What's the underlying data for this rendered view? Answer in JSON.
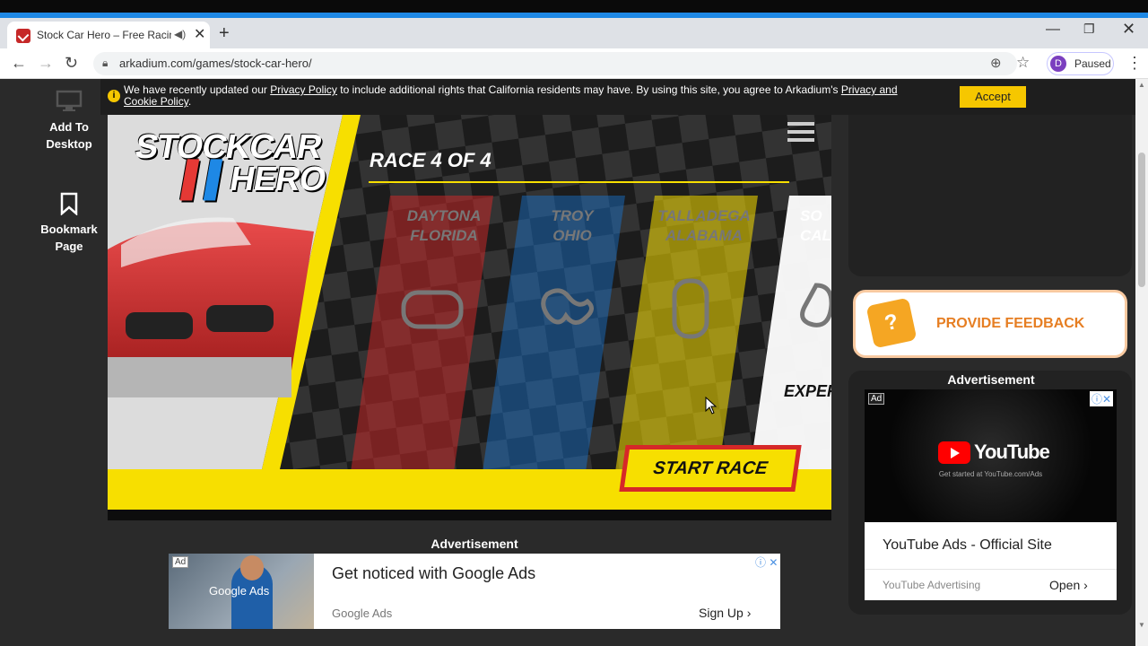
{
  "browser": {
    "tab_title": "Stock Car Hero – Free Racing",
    "tab_close": "✕",
    "new_tab": "+",
    "url": "arkadium.com/games/stock-car-hero/",
    "profile_initial": "D",
    "profile_label": "Paused",
    "window_min": "—",
    "window_restore": "❐",
    "window_close": "✕"
  },
  "sidebar": {
    "add_to_desktop": "Add To Desktop",
    "bookmark_page": "Bookmark Page"
  },
  "cookie": {
    "text_before": "We have recently updated our ",
    "privacy_link": "Privacy Policy",
    "text_middle": " to include additional rights that California residents may have. By using this site, you agree to Arkadium's ",
    "cookie_link": "Privacy and Cookie Policy",
    "text_after": ".",
    "accept": "Accept"
  },
  "game": {
    "logo_line1": "STOCKCAR",
    "logo_line2": "HERO",
    "race_header": "RACE 4 OF 4",
    "tracks": [
      {
        "line1": "DAYTONA",
        "line2": "FLORIDA",
        "color": "#c62828"
      },
      {
        "line1": "TROY",
        "line2": "OHIO",
        "color": "#1976d2"
      },
      {
        "line1": "TALLADEGA",
        "line2": "ALABAMA",
        "color": "#f9e000"
      },
      {
        "line1": "SO",
        "line2": "CALI",
        "color": "#ffffff"
      }
    ],
    "expert_label": "EXPER",
    "start_race": "START RACE"
  },
  "ads": {
    "main_label": "Advertisement",
    "main_tag": "Ad",
    "main_image_text": "Google Ads",
    "main_headline": "Get noticed with Google Ads",
    "main_source": "Google Ads",
    "main_cta": "Sign Up",
    "right_label": "Advertisement",
    "right_tag": "Ad",
    "right_brand": "YouTube",
    "right_sub": "Get started at YouTube.com/Ads",
    "right_headline": "YouTube Ads - Official Site",
    "right_source": "YouTube Advertising",
    "right_cta": "Open"
  },
  "feedback": {
    "label": "PROVIDE FEEDBACK"
  },
  "colors": {
    "accent": "#1e88e5",
    "cookie_accept": "#f6c700",
    "game_yellow": "#f7df00",
    "start_red": "#d62828",
    "feedback_orange": "#e67e22"
  }
}
